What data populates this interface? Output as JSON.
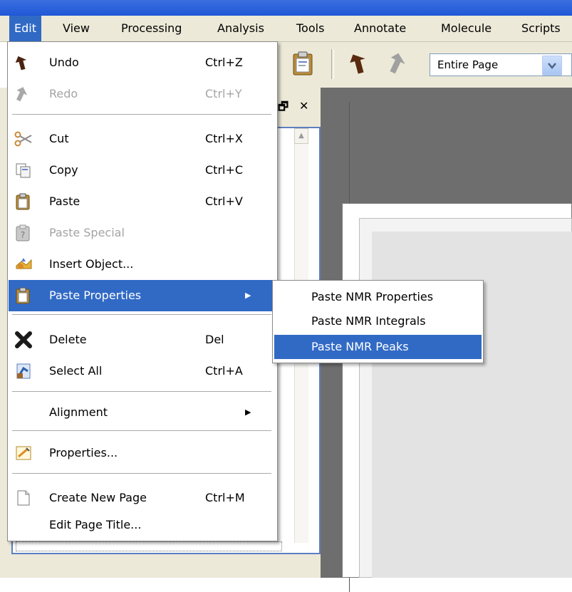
{
  "menubar": {
    "items": [
      "Edit",
      "View",
      "Processing",
      "Analysis",
      "Tools",
      "Annotate",
      "Molecule",
      "Scripts"
    ]
  },
  "toolbar": {
    "zoom_value": "Entire Page",
    "icons": [
      "paste-icon",
      "undo-icon",
      "redo-icon",
      "chevron-down-icon"
    ]
  },
  "edit_menu": {
    "items": [
      {
        "label": "Undo",
        "shortcut": "Ctrl+Z",
        "icon": "undo-icon"
      },
      {
        "label": "Redo",
        "shortcut": "Ctrl+Y",
        "icon": "redo-icon",
        "disabled": true
      },
      {
        "label": "Cut",
        "shortcut": "Ctrl+X",
        "icon": "scissors-icon"
      },
      {
        "label": "Copy",
        "shortcut": "Ctrl+C",
        "icon": "copy-icon"
      },
      {
        "label": "Paste",
        "shortcut": "Ctrl+V",
        "icon": "paste-icon"
      },
      {
        "label": "Paste Special",
        "shortcut": "",
        "icon": "paste-special-icon",
        "disabled": true
      },
      {
        "label": "Insert Object...",
        "shortcut": "",
        "icon": "insert-object-icon"
      },
      {
        "label": "Paste Properties",
        "shortcut": "",
        "icon": "paste-properties-icon",
        "submenu": true,
        "highlighted": true
      },
      {
        "label": "Delete",
        "shortcut": "Del",
        "icon": "delete-icon"
      },
      {
        "label": "Select All",
        "shortcut": "Ctrl+A",
        "icon": "select-all-icon"
      },
      {
        "label": "Alignment",
        "shortcut": "",
        "icon": "",
        "submenu": true
      },
      {
        "label": "Properties...",
        "shortcut": "",
        "icon": "properties-icon"
      },
      {
        "label": "Create New Page",
        "shortcut": "Ctrl+M",
        "icon": "new-page-icon"
      },
      {
        "label": "Edit Page Title...",
        "shortcut": "",
        "icon": ""
      }
    ]
  },
  "submenu": {
    "items": [
      "Paste NMR Properties",
      "Paste NMR Integrals",
      "Paste NMR Peaks"
    ],
    "highlighted": "Paste NMR Peaks"
  },
  "colors": {
    "highlight": "#316ac5",
    "menubar": "#ece9d8",
    "workspace": "#6e6e6e"
  }
}
